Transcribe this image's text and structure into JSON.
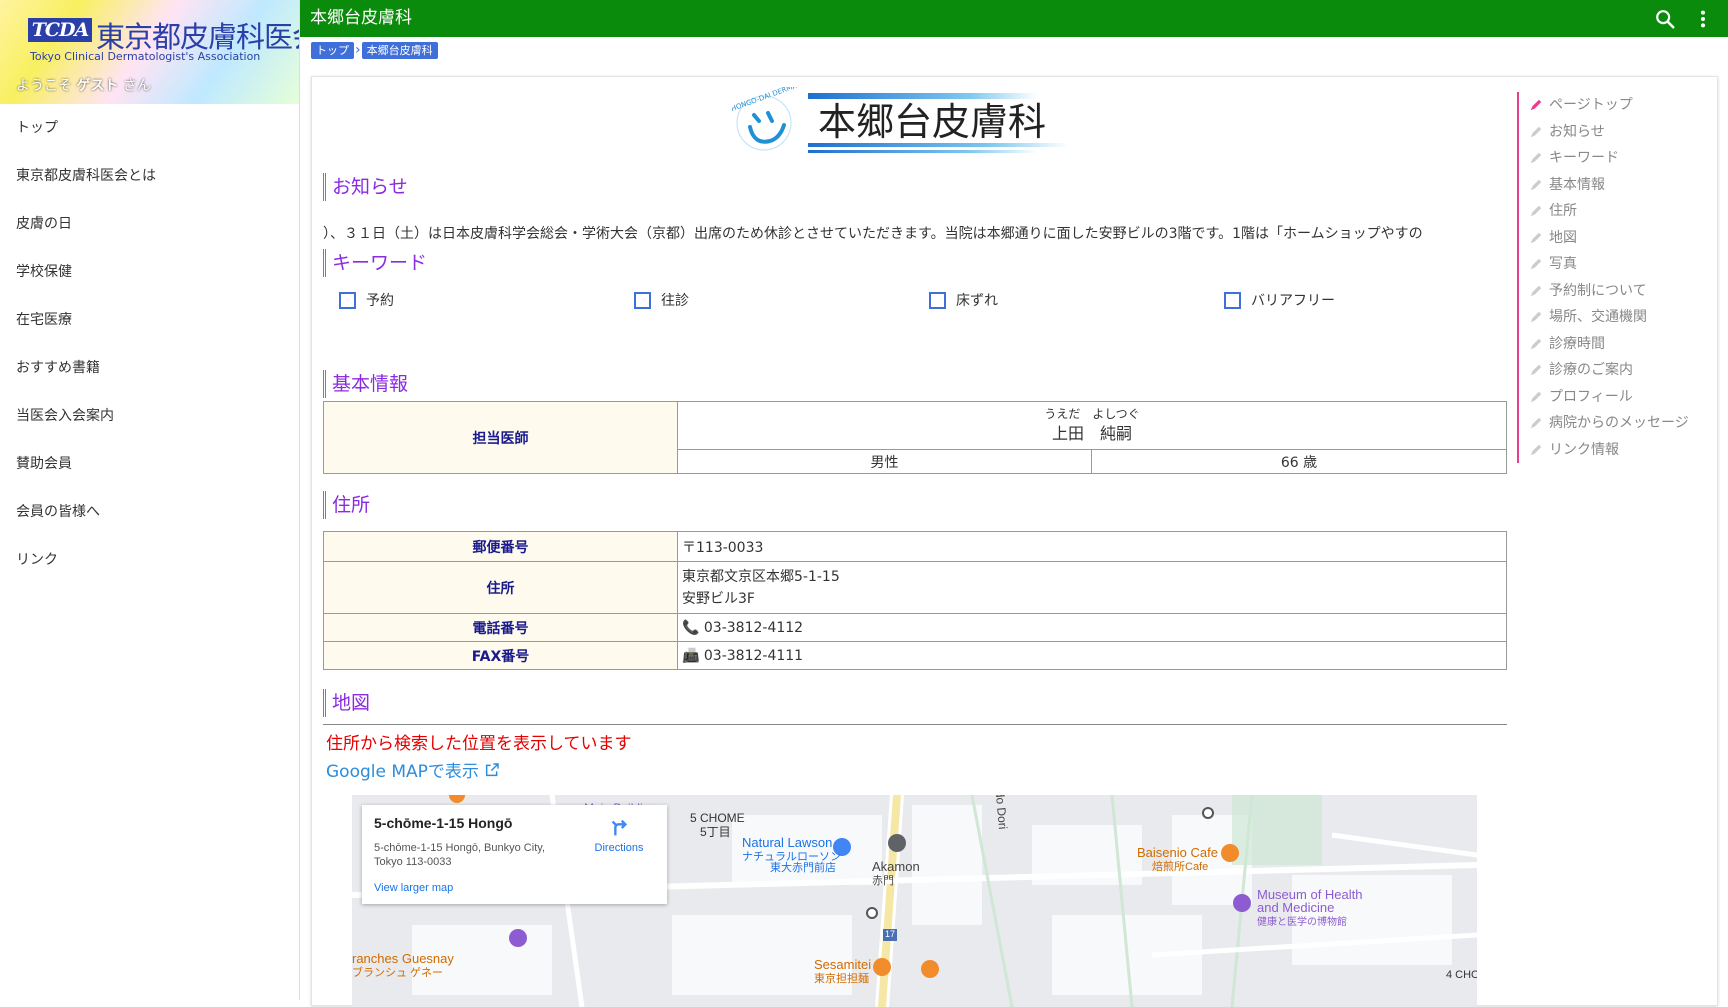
{
  "sidebar": {
    "logo_mark": "TCDA",
    "logo_title": "東京都皮膚科医会",
    "logo_subtitle": "Tokyo Clinical Dermatologist's Association",
    "welcome_prefix": "ようこそ",
    "welcome_user": "ゲスト",
    "welcome_suffix": "さん",
    "nav": [
      "トップ",
      "東京都皮膚科医会とは",
      "皮膚の日",
      "学校保健",
      "在宅医療",
      "おすすめ書籍",
      "当医会入会案内",
      "賛助会員",
      "会員の皆様へ",
      "リンク"
    ]
  },
  "topbar": {
    "title": "本郷台皮膚科"
  },
  "breadcrumb": {
    "home": "トップ",
    "current": "本郷台皮膚科"
  },
  "hospital": {
    "name": "本郷台皮膚科",
    "logo_en": "HONGO-DAI DERMATOLOGY"
  },
  "sections": {
    "news": "お知らせ",
    "keywords": "キーワード",
    "basic": "基本情報",
    "address": "住所",
    "map": "地図"
  },
  "news_text": "）、３１日（土）は日本皮膚科学会総会・学術大会（京都）出席のため休診とさせていただきます。当院は本郷通りに面した安野ビルの3階です。1階は「ホームショップやすの",
  "keywords": [
    "予約",
    "往診",
    "床ずれ",
    "バリアフリー"
  ],
  "basic": {
    "doctor_label": "担当医師",
    "doctor_kana": "うえだ　よしつぐ",
    "doctor_name": "上田　純嗣",
    "gender": "男性",
    "age": "66 歳"
  },
  "address": {
    "postal_label": "郵便番号",
    "postal": "〒113-0033",
    "addr_label": "住所",
    "addr_line1": "東京都文京区本郷5-1-15",
    "addr_line2": "安野ビル3F",
    "tel_label": "電話番号",
    "tel": "03-3812-4112",
    "fax_label": "FAX番号",
    "fax": "03-3812-4111"
  },
  "map": {
    "note": "住所から検索した位置を表示しています",
    "link": "Google MAPで表示",
    "info_title": "5-chōme-1-15 Hongō",
    "info_addr": "5-chōme-1-15 Hongō, Bunkyo City, Tokyo 113-0033",
    "info_larger": "View larger map",
    "directions": "Directions",
    "labels": {
      "chome": "5 CHOME",
      "chome_jp": "5丁目",
      "lawson": "Natural Lawson",
      "lawson_jp1": "ナチュラルローソン",
      "lawson_jp2": "東大赤門前店",
      "akamon": "Akamon",
      "akamon_jp": "赤門",
      "baisenio": "Baisenio Cafe",
      "baisenio_jp": "焙煎所Cafe",
      "museum1": "Museum of Health",
      "museum2": "and Medicine",
      "museum_jp": "健康と医学の博物館",
      "guesnay": "ranches Guesnay",
      "guesnay_jp": "ブランシュ ゲネー",
      "sesamitei": "Sesamitei",
      "sesamitei_jp": "東京担担麺",
      "route": "17",
      "dori": "do Dori",
      "building": "Main Building",
      "chome4": "4 CHO"
    }
  },
  "toc": [
    "ページトップ",
    "お知らせ",
    "キーワード",
    "基本情報",
    "住所",
    "地図",
    "写真",
    "予約制について",
    "場所、交通機関",
    "診療時間",
    "診療のご案内",
    "プロフィール",
    "病院からのメッセージ",
    "リンク情報"
  ]
}
